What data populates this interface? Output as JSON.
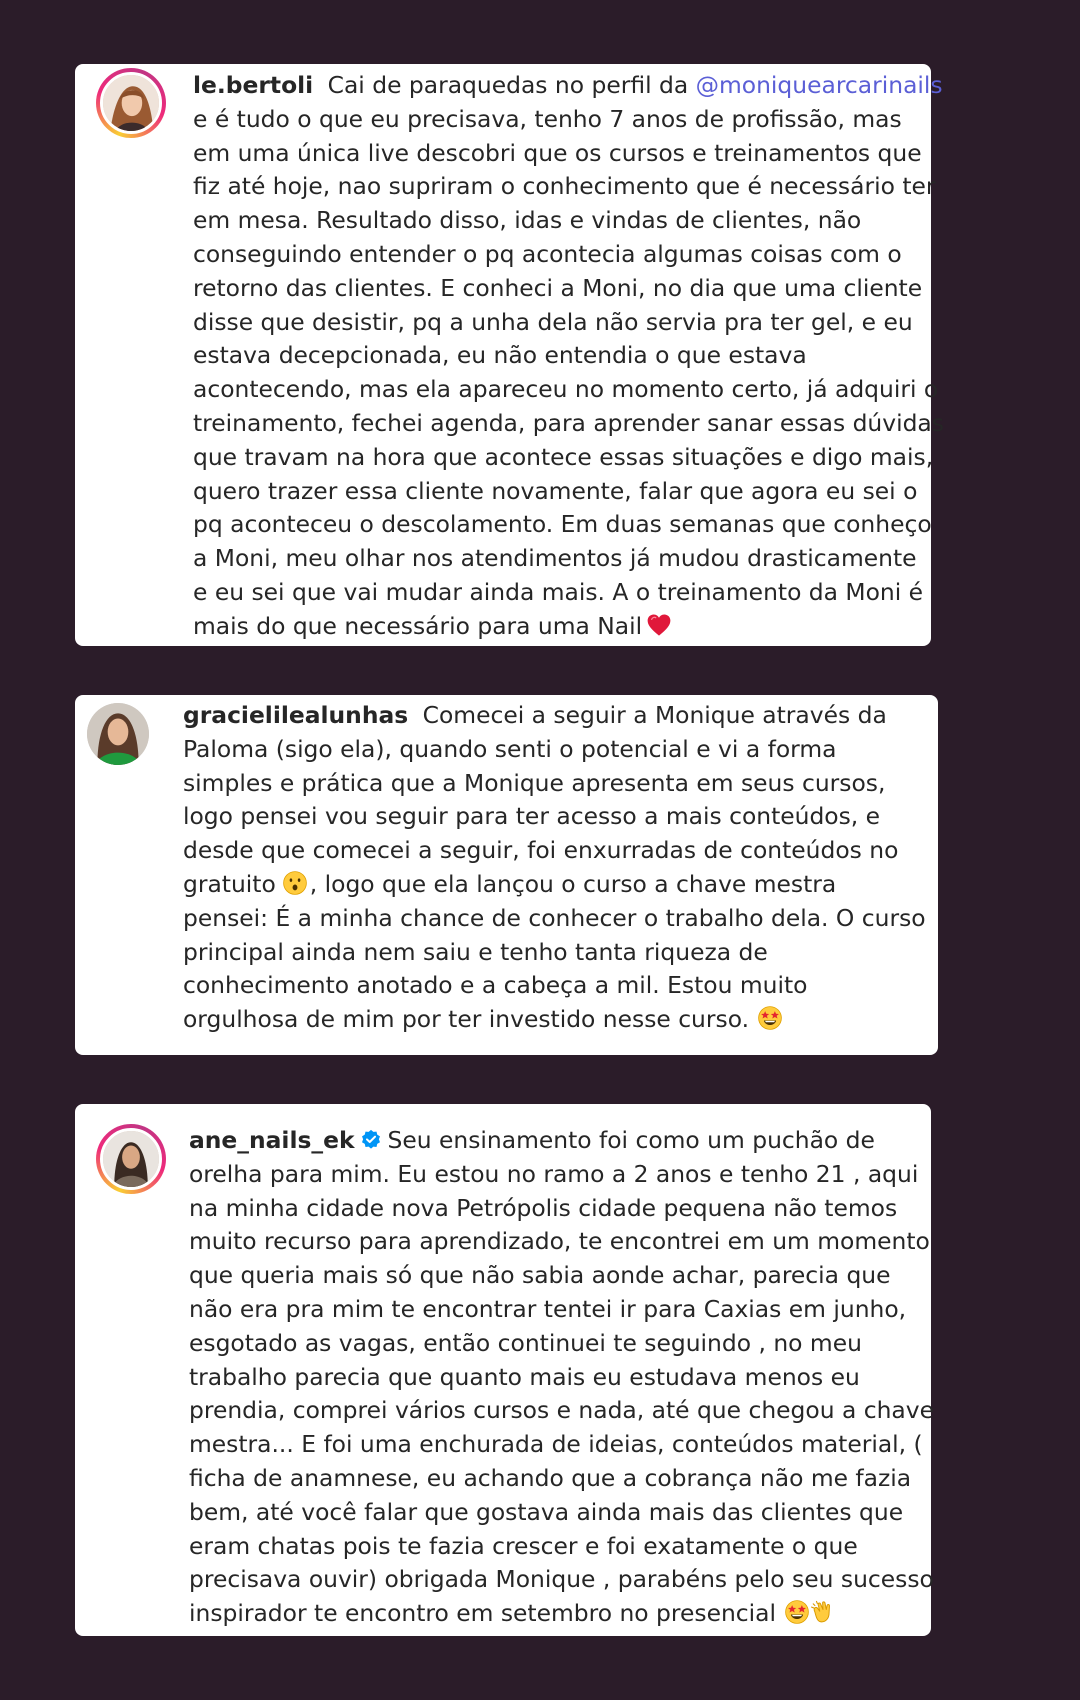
{
  "colors": {
    "page_background": "#2b1c29",
    "card_background": "#ffffff",
    "text": "#262626",
    "mention": "#5b5fd6",
    "verified_badge": "#0095f6"
  },
  "comments": [
    {
      "username": "le.bertoli",
      "avatar_icon": "profile-photo-icon",
      "story_ring": true,
      "verified": false,
      "first_line_text": " Cai de paraquedas no perfil da ",
      "mention": "@moniquearcarinails",
      "lines": [
        "e é tudo o que eu precisava, tenho 7 anos de profissão, mas",
        "em uma única live descobri que os cursos e treinamentos que",
        "fiz até hoje, nao supriram o conhecimento que é necessário ter",
        "em mesa. Resultado disso, idas e vindas de clientes, não",
        "conseguindo entender o pq acontecia algumas coisas com o",
        "retorno das clientes. E conheci a Moni, no dia que uma cliente",
        "disse que desistir, pq a unha dela não servia pra ter gel, e eu",
        "estava decepcionada, eu não entendia o que estava",
        "acontecendo, mas ela apareceu no momento certo, já adquiri o",
        "treinamento, fechei agenda, para aprender sanar essas dúvidas",
        "que travam na hora que acontece essas situações e digo mais,",
        "quero trazer essa cliente novamente, falar que agora eu sei o",
        "pq aconteceu o descolamento. Em duas semanas que conheço",
        "a Moni, meu olhar nos atendimentos já mudou drasticamente",
        "e eu sei que vai mudar ainda mais. A o treinamento da Moni é"
      ],
      "last_line": "mais do que necessário para uma Nail",
      "emojis": [
        "red-heart-icon"
      ]
    },
    {
      "username": "gracielilealunhas",
      "avatar_icon": "profile-photo-icon",
      "story_ring": false,
      "verified": false,
      "first_line_text": " Comecei a seguir a Monique através da",
      "lines": [
        "Paloma (sigo ela), quando senti o potencial e vi a forma",
        "simples e prática que a Monique apresenta em seus cursos,",
        "logo pensei vou seguir para ter acesso a mais conteúdos, e",
        "desde que comecei a seguir, foi enxurradas de conteúdos no"
      ],
      "mid_line_before": "gratuito",
      "mid_emoji": "hushed-face-icon",
      "mid_line_after": ", logo que ela lançou o curso a chave mestra",
      "lines_after": [
        "pensei: É a minha chance de conhecer o trabalho dela. O curso",
        "principal ainda nem saiu e tenho tanta riqueza de",
        "conhecimento anotado e a cabeça a mil. Estou muito"
      ],
      "last_line": "orgulhosa de mim por ter investido nesse curso.",
      "emojis": [
        "star-struck-icon"
      ]
    },
    {
      "username": "ane_nails_ek",
      "avatar_icon": "profile-photo-icon",
      "story_ring": true,
      "verified": true,
      "first_line_text": "Seu ensinamento foi como um puchão de",
      "lines": [
        "orelha para mim. Eu estou no ramo a 2 anos e tenho 21 , aqui",
        "na minha cidade nova Petrópolis cidade pequena não temos",
        "muito recurso para aprendizado, te encontrei em um momento",
        "que queria mais só que não sabia aonde achar, parecia que",
        "não era pra mim te encontrar tentei ir para Caxias em junho,",
        "esgotado as vagas, então continuei te seguindo , no meu",
        "trabalho parecia que quanto mais eu estudava menos eu",
        "prendia, comprei vários cursos e nada, até que chegou a chave",
        "mestra... E foi uma enchurada de ideias, conteúdos material, (",
        "ficha de anamnese, eu achando que a cobrança não me fazia",
        "bem, até você falar que gostava ainda mais das clientes que",
        "eram chatas pois te fazia crescer e foi exatamente o que",
        "precisava ouvir) obrigada Monique , parabéns pelo seu sucesso"
      ],
      "last_line": "inspirador te encontro em setembro no presencial",
      "emojis": [
        "star-struck-icon",
        "clapping-hands-icon"
      ]
    }
  ]
}
